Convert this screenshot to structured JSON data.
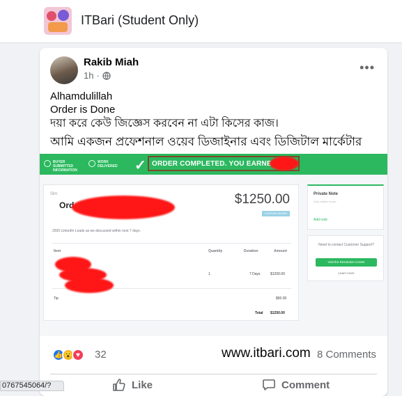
{
  "group": {
    "title": "ITBari (Student Only)",
    "icon": "group-cover-icon"
  },
  "post": {
    "author": "Rakib Miah",
    "time": "1h",
    "privacy_icon": "globe-icon",
    "more_icon": "more-dots-icon",
    "more_glyph": "•••",
    "lines": [
      "Alhamdulillah",
      "Order is Done",
      "দয়া করে কেউ জিজ্ঞেস করবেন না এটা কিসের কাজ।",
      "আমি একজন প্রফেশনাল ওয়েব ডিজাইনার এবং ডিজিটাল মার্কেটার"
    ]
  },
  "screenshot": {
    "accent": "#2cb85f",
    "step1": "BUYER SUBMITTED INFORMATION",
    "step2": "WORK DELIVERED",
    "banner": "ORDER COMPLETED. YOU EARNED",
    "order_label": "Ord",
    "order_small": "Slm",
    "price": "$1250.00",
    "badge": "CUSTOM ORDER",
    "description": "2500 LinkedIn Leads as we discussed within next 7 days.",
    "columns": {
      "item": "Item",
      "quantity": "Quantity",
      "duration": "Duration",
      "amount": "Amount"
    },
    "row": {
      "quantity": "1",
      "duration": "7 Days",
      "amount": "$1200.00"
    },
    "tip": {
      "label": "Tip",
      "amount": "$50.00"
    },
    "total": {
      "label": "Total",
      "amount": "$1250.00"
    },
    "private_note": {
      "title": "Private Note",
      "subtitle": "Only visible to you",
      "add": "Add note"
    },
    "support": {
      "question": "Need to contact Customer Support?",
      "button": "Visit the Resolution Center",
      "more": "Learn more"
    }
  },
  "stats": {
    "reactions": [
      "like-reaction-icon",
      "wow-reaction-icon",
      "love-reaction-icon"
    ],
    "count": "32",
    "watermark": "www.itbari.com",
    "comments": "8 Comments"
  },
  "actions": {
    "like": "Like",
    "comment": "Comment"
  },
  "status_url": "0767545064/?"
}
